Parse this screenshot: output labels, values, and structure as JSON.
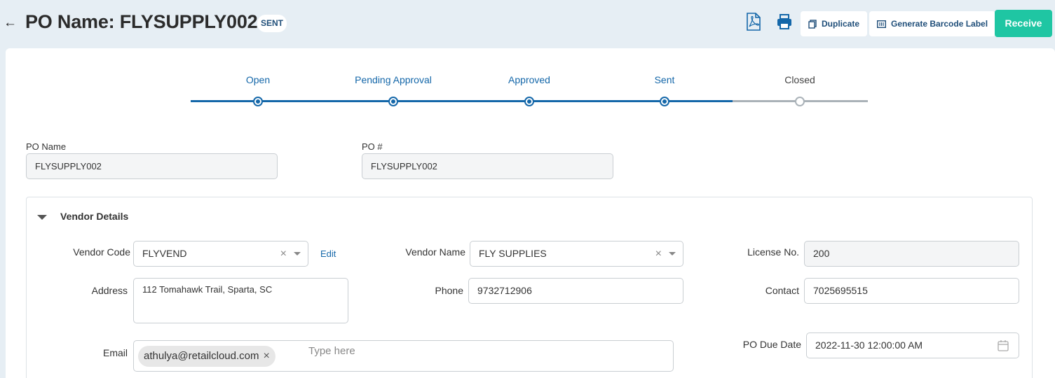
{
  "header": {
    "back_icon": "arrow-left-icon",
    "title": "PO Name: FLYSUPPLY002",
    "status_badge": "SENT",
    "pdf_icon": "pdf-icon",
    "print_icon": "printer-icon",
    "duplicate_label": "Duplicate",
    "barcode_label": "Generate Barcode Label",
    "receive_label": "Receive"
  },
  "colors": {
    "accent": "#1467a9",
    "receive": "#1fc6a3",
    "pending": "#aab2b8",
    "background": "#e6eef4"
  },
  "stepper": {
    "steps": [
      {
        "label": "Open",
        "status": "done"
      },
      {
        "label": "Pending Approval",
        "status": "done"
      },
      {
        "label": "Approved",
        "status": "done"
      },
      {
        "label": "Sent",
        "status": "done"
      },
      {
        "label": "Closed",
        "status": "pending"
      }
    ]
  },
  "po": {
    "name_label": "PO Name",
    "name_value": "FLYSUPPLY002",
    "number_label": "PO #",
    "number_value": "FLYSUPPLY002"
  },
  "vendor": {
    "section_title": "Vendor Details",
    "code_label": "Vendor Code",
    "code_value": "FLYVEND",
    "edit_label": "Edit",
    "name_label": "Vendor Name",
    "name_value": "FLY SUPPLIES",
    "license_label": "License No.",
    "license_value": "200",
    "address_label": "Address",
    "address_value": "112 Tomahawk Trail, Sparta, SC",
    "phone_label": "Phone",
    "phone_value": "9732712906",
    "contact_label": "Contact",
    "contact_value": "7025695515",
    "email_label": "Email",
    "email_chip": "athulya@retailcloud.com",
    "email_placeholder": "Type here",
    "due_date_label": "PO Due Date",
    "due_date_value": "2022-11-30 12:00:00 AM"
  }
}
